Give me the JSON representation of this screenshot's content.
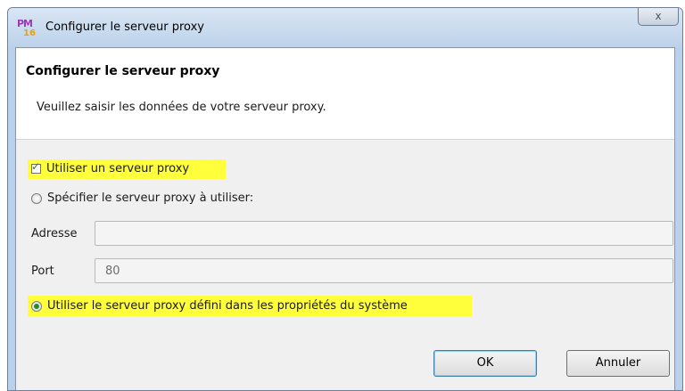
{
  "window": {
    "title": "Configurer le serveur proxy",
    "app_icon": {
      "icon": "pm16-app-icon",
      "letters": "PM",
      "number": "16"
    },
    "close_label": "x"
  },
  "header": {
    "title": "Configurer le serveur proxy",
    "subtitle": "Veuillez saisir les données de votre serveur proxy."
  },
  "options": {
    "use_proxy": {
      "label": "Utiliser un serveur proxy",
      "checked": true
    },
    "specify_proxy": {
      "label": "Spécifier le serveur proxy à utiliser:",
      "selected": false
    },
    "system_proxy": {
      "label": "Utiliser le serveur proxy défini dans les propriétés du système",
      "selected": true
    }
  },
  "fields": {
    "address": {
      "label": "Adresse",
      "value": ""
    },
    "port": {
      "label": "Port",
      "value": "80"
    }
  },
  "buttons": {
    "ok": "OK",
    "cancel": "Annuler"
  },
  "colors": {
    "highlight": "#ffff3c",
    "title_bar": "#bcd2ea",
    "dialog_bg": "#f0f0f0"
  }
}
